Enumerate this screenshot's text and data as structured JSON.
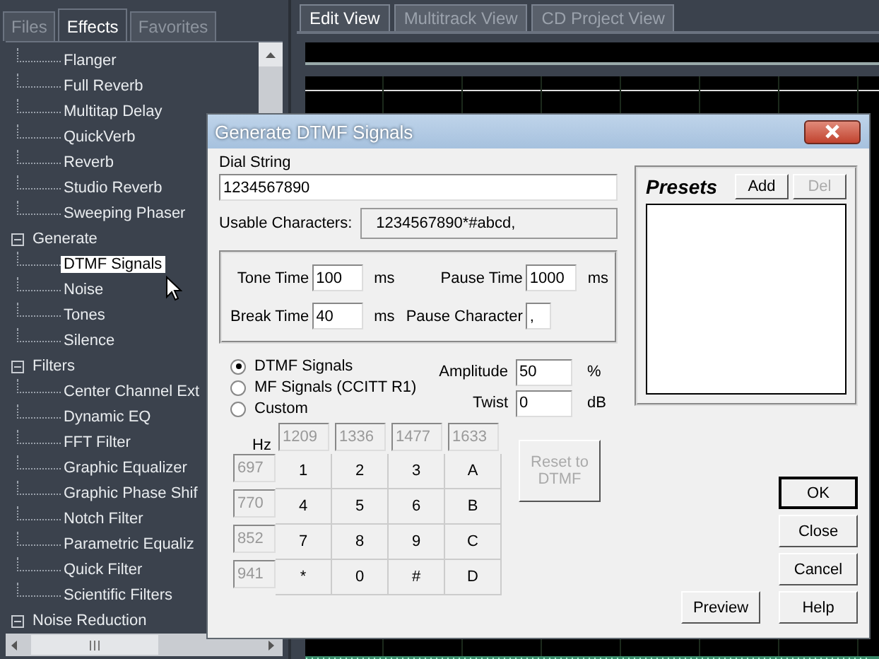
{
  "panel_tabs": [
    {
      "label": "Files",
      "selected": false
    },
    {
      "label": "Effects",
      "selected": true
    },
    {
      "label": "Favorites",
      "selected": false
    }
  ],
  "tree_top": [
    {
      "label": "Flanger",
      "selected": false
    },
    {
      "label": "Full Reverb",
      "selected": false
    },
    {
      "label": "Multitap Delay",
      "selected": false
    },
    {
      "label": "QuickVerb",
      "selected": false
    },
    {
      "label": "Reverb",
      "selected": false
    },
    {
      "label": "Studio Reverb",
      "selected": false
    },
    {
      "label": "Sweeping Phaser",
      "selected": false
    }
  ],
  "tree": [
    {
      "label": "Generate",
      "expanded": true,
      "children": [
        {
          "label": "DTMF Signals",
          "selected": true
        },
        {
          "label": "Noise",
          "selected": false
        },
        {
          "label": "Tones",
          "selected": false
        },
        {
          "label": "Silence",
          "selected": false
        }
      ]
    },
    {
      "label": "Filters",
      "expanded": true,
      "children": [
        {
          "label": "Center Channel Ext",
          "selected": false
        },
        {
          "label": "Dynamic EQ",
          "selected": false
        },
        {
          "label": "FFT Filter",
          "selected": false
        },
        {
          "label": "Graphic Equalizer",
          "selected": false
        },
        {
          "label": "Graphic Phase Shif",
          "selected": false
        },
        {
          "label": "Notch Filter",
          "selected": false
        },
        {
          "label": "Parametric Equaliz",
          "selected": false
        },
        {
          "label": "Quick Filter",
          "selected": false
        },
        {
          "label": "Scientific Filters",
          "selected": false
        }
      ]
    },
    {
      "label": "Noise Reduction",
      "expanded": true
    }
  ],
  "view_tabs": [
    {
      "label": "Edit View",
      "selected": true
    },
    {
      "label": "Multitrack View",
      "selected": false
    },
    {
      "label": "CD Project View",
      "selected": false
    }
  ],
  "dialog": {
    "title": "Generate DTMF Signals",
    "dial_string": {
      "label": "Dial String",
      "value": "1234567890"
    },
    "usable_characters": {
      "label": "Usable Characters:",
      "value": "1234567890*#abcd,"
    },
    "timing": [
      {
        "label": "Tone Time",
        "value": "100",
        "unit": "ms"
      },
      {
        "label": "Pause Time",
        "value": "1000",
        "unit": "ms"
      },
      {
        "label": "Break Time",
        "value": "40",
        "unit": "ms"
      },
      {
        "label": "Pause Character",
        "value": ","
      }
    ],
    "modes": [
      {
        "label": "DTMF Signals",
        "selected": true
      },
      {
        "label": "MF Signals (CCITT R1)",
        "selected": false
      },
      {
        "label": "Custom",
        "selected": false
      }
    ],
    "levels": [
      {
        "label": "Amplitude",
        "value": "50",
        "unit": "%"
      },
      {
        "label": "Twist",
        "value": "0",
        "unit": "dB"
      }
    ],
    "keypad": {
      "hz_label": "Hz",
      "column_freqs": [
        "1209",
        "1336",
        "1477",
        "1633"
      ],
      "disabled": true,
      "rows": [
        {
          "freq": "697",
          "keys": [
            "1",
            "2",
            "3",
            "A"
          ]
        },
        {
          "freq": "770",
          "keys": [
            "4",
            "5",
            "6",
            "B"
          ]
        },
        {
          "freq": "852",
          "keys": [
            "7",
            "8",
            "9",
            "C"
          ]
        },
        {
          "freq": "941",
          "keys": [
            "*",
            "0",
            "#",
            "D"
          ]
        }
      ]
    },
    "reset_button": {
      "label": "Reset to DTMF",
      "disabled": true
    },
    "presets": {
      "title": "Presets",
      "buttons": [
        {
          "label": "Add",
          "disabled": false
        },
        {
          "label": "Del",
          "disabled": true
        }
      ]
    },
    "side_buttons": [
      {
        "label": "OK",
        "default": true
      },
      {
        "label": "Close",
        "default": false
      },
      {
        "label": "Cancel",
        "default": false
      }
    ],
    "bottom_buttons": [
      {
        "label": "Preview",
        "default": false
      },
      {
        "label": "Help",
        "default": false
      }
    ]
  }
}
